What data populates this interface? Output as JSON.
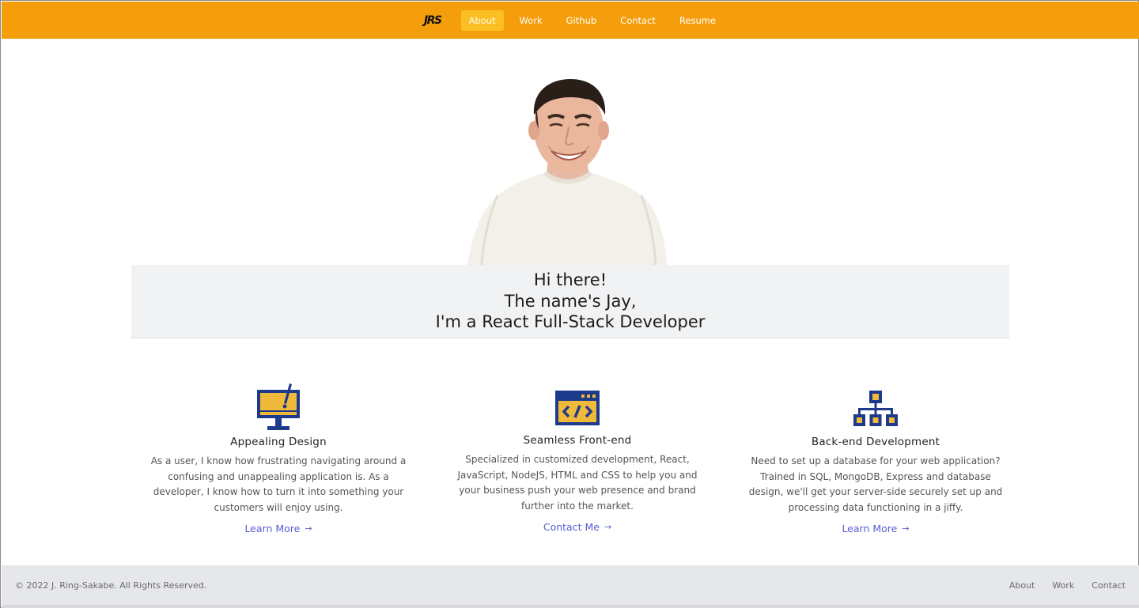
{
  "nav": {
    "logo": "JRS",
    "links": [
      "About",
      "Work",
      "Github",
      "Contact",
      "Resume"
    ],
    "active_index": 0
  },
  "hero": {
    "line1": "Hi there!",
    "line2": "The name's Jay,",
    "line3": "I'm a React Full-Stack Developer"
  },
  "features": [
    {
      "icon": "monitor-design-icon",
      "title": "Appealing Design",
      "desc_lines": [
        "As a user, I know how frustrating navigating around a",
        "confusing and unappealing application is. As a",
        "developer, I know how to turn it into something your",
        "customers will enjoy using."
      ],
      "link": "Learn More"
    },
    {
      "icon": "code-window-icon",
      "title": "Seamless Front-end",
      "desc_lines": [
        "Specialized in customized development, React,",
        "JavaScript, NodeJS, HTML and CSS to help you and",
        "your business push your web presence and brand",
        "further into the market."
      ],
      "link": "Contact Me"
    },
    {
      "icon": "sitemap-network-icon",
      "title": "Back-end Development",
      "desc_lines": [
        "Need to set up a database for your web application?",
        "Trained in SQL, MongoDB, Express and database",
        "design, we'll get your server-side securely set up and",
        "processing data functioning in a jiffy."
      ],
      "link": "Learn More"
    }
  ],
  "footer": {
    "copyright": "© 2022 J. Ring-Sakabe. All Rights Reserved.",
    "links": [
      "About",
      "Work",
      "Contact"
    ]
  },
  "colors": {
    "navbar": "#f59e0c",
    "active_link": "#fbbf24",
    "icon_blue": "#1e3a8a",
    "icon_yellow": "#f0b93a",
    "link": "#5b5bd6"
  }
}
